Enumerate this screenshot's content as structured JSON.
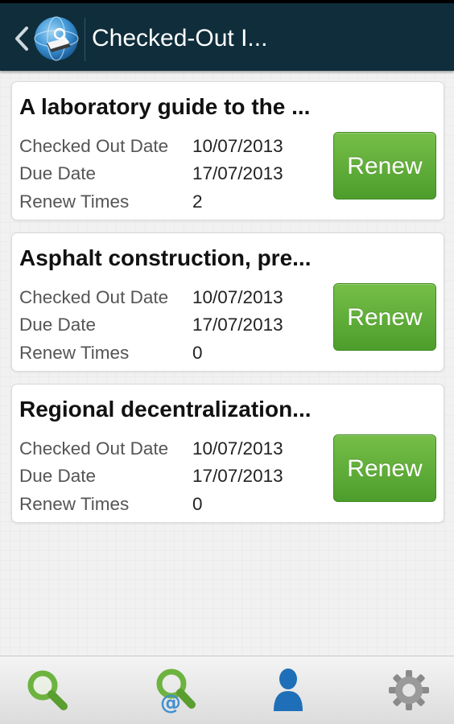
{
  "action_bar": {
    "title": "Checked-Out I...",
    "logo_icon": "library-globe-book-icon",
    "up_icon": "chevron-left-icon",
    "background": "#0f2d3b"
  },
  "items": [
    {
      "title": "A laboratory guide to the ...",
      "checked_out_label": "Checked Out Date",
      "checked_out_value": "10/07/2013",
      "due_label": "Due Date",
      "due_value": "17/07/2013",
      "renew_times_label": "Renew Times",
      "renew_times_value": "2",
      "renew_label": "Renew"
    },
    {
      "title": "Asphalt construction, pre...",
      "checked_out_label": "Checked Out Date",
      "checked_out_value": "10/07/2013",
      "due_label": "Due Date",
      "due_value": "17/07/2013",
      "renew_times_label": "Renew Times",
      "renew_times_value": "0",
      "renew_label": "Renew"
    },
    {
      "title": "Regional decentralization...",
      "checked_out_label": "Checked Out Date",
      "checked_out_value": "10/07/2013",
      "due_label": "Due Date",
      "due_value": "17/07/2013",
      "renew_times_label": "Renew Times",
      "renew_times_value": "0",
      "renew_label": "Renew"
    }
  ],
  "bottom_nav": {
    "tabs": [
      {
        "icon": "search-icon",
        "active": false
      },
      {
        "icon": "email-search-icon",
        "active": false
      },
      {
        "icon": "account-icon",
        "active": true
      },
      {
        "icon": "settings-gear-icon",
        "active": false
      }
    ]
  },
  "colors": {
    "renew_button": "#5cae36",
    "search_icon": "#6db33f",
    "account_icon": "#1f6fb8",
    "gear_icon": "#8a8a8a"
  }
}
